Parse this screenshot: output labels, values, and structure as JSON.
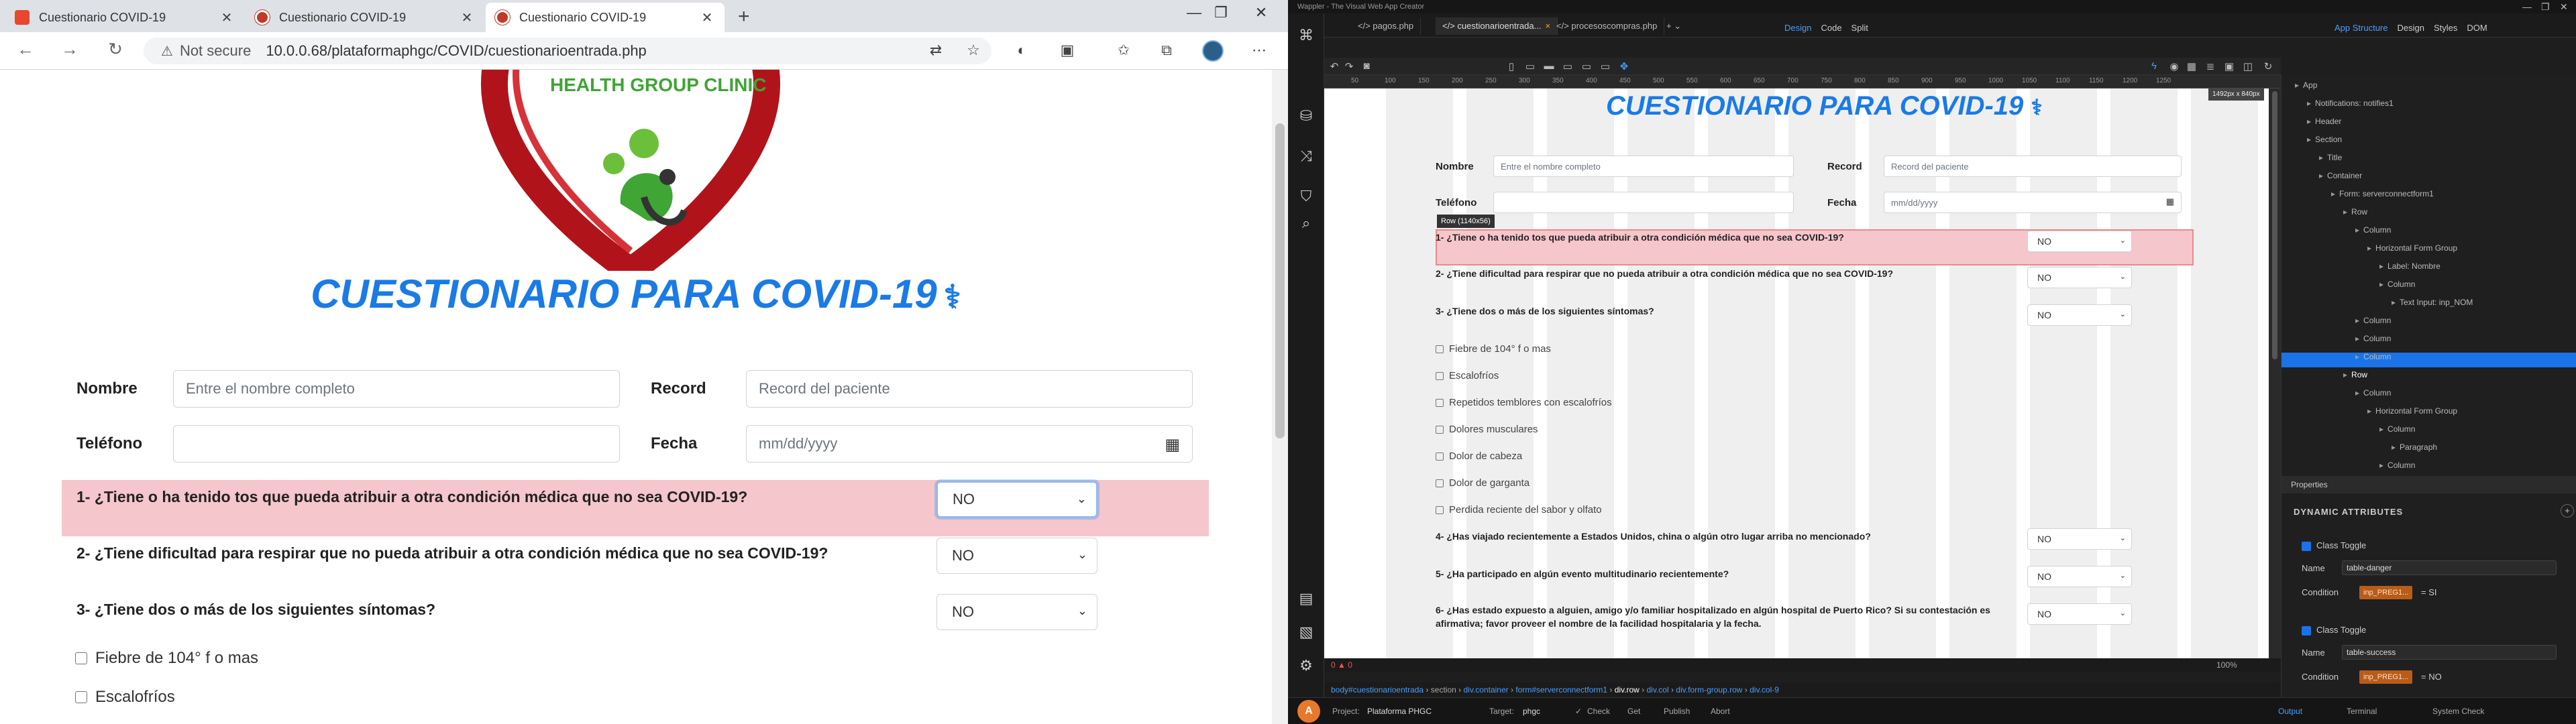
{
  "browser": {
    "tabs": [
      {
        "label": "Cuestionario COVID-19",
        "active": false,
        "favicon": "orange-square-icon"
      },
      {
        "label": "Cuestionario COVID-19",
        "active": false,
        "favicon": "heart-logo-icon"
      },
      {
        "label": "Cuestionario COVID-19",
        "active": true,
        "favicon": "heart-logo-icon"
      }
    ],
    "not_secure": "Not secure",
    "url": "10.0.0.68/plataformaphgc/COVID/cuestionarioentrada.php"
  },
  "page": {
    "logo_text": "HEALTH GROUP CLINIC",
    "title": "CUESTIONARIO PARA COVID-19",
    "form": {
      "nombre_label": "Nombre",
      "nombre_placeholder": "Entre el nombre completo",
      "record_label": "Record",
      "record_placeholder": "Record del paciente",
      "telefono_label": "Teléfono",
      "fecha_label": "Fecha",
      "fecha_placeholder": "mm/dd/yyyy"
    },
    "questions": [
      {
        "text": "1- ¿Tiene o ha tenido tos que pueda atribuir a otra condición médica que no sea COVID-19?",
        "answer": "NO",
        "danger": true
      },
      {
        "text": "2- ¿Tiene dificultad para respirar que no pueda atribuir a otra condición médica que no sea COVID-19?",
        "answer": "NO",
        "danger": false
      },
      {
        "text": "3- ¿Tiene dos o más de los siguientes síntomas?",
        "answer": "NO",
        "danger": false
      }
    ],
    "symptoms": [
      "Fiebre de 104° f o mas",
      "Escalofríos"
    ]
  },
  "wappler": {
    "title_text": "Wappler - The Visual Web App Creator",
    "file_tabs": [
      {
        "label": "pagos.php",
        "active": false
      },
      {
        "label": "cuestionarioentrada...",
        "active": true
      },
      {
        "label": "procesoscompras.php",
        "active": false
      }
    ],
    "modes": [
      "Design",
      "Code",
      "Split"
    ],
    "panel_tabs": [
      "App Structure",
      "Design",
      "Styles",
      "DOM"
    ],
    "ruler": [
      "50",
      "100",
      "150",
      "200",
      "250",
      "300",
      "350",
      "400",
      "450",
      "500",
      "550",
      "600",
      "650",
      "700",
      "750",
      "800",
      "850",
      "900",
      "950",
      "1000",
      "1050",
      "1100",
      "1150",
      "1200",
      "1250"
    ],
    "size_badge": "1492px x 840px",
    "row_badge": "Row (1140x56)",
    "canvas_symptoms": [
      "Fiebre de 104° f o mas",
      "Escalofríos",
      "Repetidos temblores con escalofríos",
      "Dolores musculares",
      "Dolor de cabeza",
      "Dolor de garganta",
      "Perdida reciente del sabor y olfato"
    ],
    "canvas_questions_extra": [
      {
        "text": "4- ¿Has viajado recientemente a Estados Unidos, china o algún otro lugar arriba no mencionado?",
        "answer": "NO"
      },
      {
        "text": "5- ¿Ha participado en algún evento multitudinario recientemente?",
        "answer": "NO"
      },
      {
        "text": "6- ¿Has estado expuesto a alguien, amigo y/o familiar hospitalizado en algún hospital de Puerto Rico? Si su contestación es afirmativa; favor proveer el nombre de la facilidad hospitalaria y la fecha.",
        "answer": "NO"
      }
    ],
    "status_left": "0 ▲ 0",
    "zoom": "100%",
    "breadcrumb": [
      "body#cuestionarioentrada",
      "section",
      "div.container",
      "form#serverconnectform1",
      "div.row",
      "div.col",
      "div.form-group.row",
      "div.col-9"
    ],
    "bottom": {
      "project_label": "Project:",
      "project": "Plataforma PHGC",
      "target_label": "Target:",
      "target": "phgc",
      "check": "Check",
      "get": "Get",
      "publish": "Publish",
      "abort": "Abort",
      "output": "Output",
      "terminal": "Terminal",
      "system_check": "System Check"
    },
    "tree": [
      {
        "label": "App",
        "indent": 0
      },
      {
        "label": "Notifications: notifies1",
        "indent": 1
      },
      {
        "label": "Header",
        "indent": 1
      },
      {
        "label": "Section",
        "indent": 1
      },
      {
        "label": "Title",
        "indent": 2
      },
      {
        "label": "Container",
        "indent": 2
      },
      {
        "label": "Form: serverconnectform1",
        "indent": 3
      },
      {
        "label": "Row",
        "indent": 4
      },
      {
        "label": "Column",
        "indent": 5
      },
      {
        "label": "Horizontal Form Group",
        "indent": 6
      },
      {
        "label": "Label: Nombre",
        "indent": 7
      },
      {
        "label": "Column",
        "indent": 7
      },
      {
        "label": "Text Input: inp_NOM",
        "indent": 8
      },
      {
        "label": "Column",
        "indent": 5
      },
      {
        "label": "Column",
        "indent": 5
      },
      {
        "label": "Column",
        "indent": 5
      },
      {
        "label": "Row",
        "indent": 4
      },
      {
        "label": "Column",
        "indent": 5
      },
      {
        "label": "Horizontal Form Group",
        "indent": 6
      },
      {
        "label": "Column",
        "indent": 7
      },
      {
        "label": "Paragraph",
        "indent": 8
      },
      {
        "label": "Column",
        "indent": 7
      }
    ],
    "properties_title": "Properties",
    "dynamic_attributes": "DYNAMIC ATTRIBUTES",
    "class_toggle_1": {
      "title": "Class Toggle",
      "name_label": "Name",
      "name": "table-danger",
      "cond_label": "Condition",
      "cond_tag": "inp_PREG1...",
      "cond_rest": "= SI"
    },
    "class_toggle_2": {
      "title": "Class Toggle",
      "name_label": "Name",
      "name": "table-success",
      "cond_label": "Condition",
      "cond_tag": "inp_PREG1...",
      "cond_rest": "= NO"
    }
  }
}
